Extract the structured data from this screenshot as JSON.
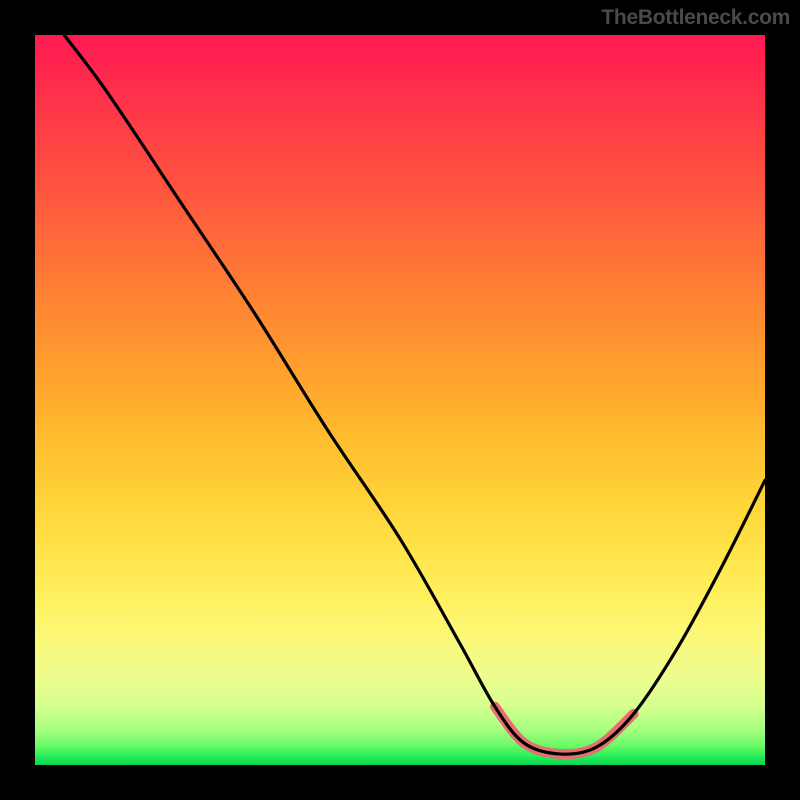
{
  "attribution": "TheBottleneck.com",
  "chart_data": {
    "type": "line",
    "title": "",
    "xlabel": "",
    "ylabel": "",
    "xlim": [
      0,
      100
    ],
    "ylim": [
      0,
      100
    ],
    "grid": false,
    "region_band": {
      "x_start": 62,
      "x_end": 82,
      "color": "#e76f6f"
    },
    "curve_points": [
      {
        "x": 4,
        "y": 100
      },
      {
        "x": 10,
        "y": 92
      },
      {
        "x": 20,
        "y": 77
      },
      {
        "x": 30,
        "y": 62
      },
      {
        "x": 40,
        "y": 46
      },
      {
        "x": 50,
        "y": 31
      },
      {
        "x": 58,
        "y": 17
      },
      {
        "x": 63,
        "y": 8
      },
      {
        "x": 67,
        "y": 3
      },
      {
        "x": 72,
        "y": 1.5
      },
      {
        "x": 77,
        "y": 2.5
      },
      {
        "x": 82,
        "y": 7
      },
      {
        "x": 88,
        "y": 16
      },
      {
        "x": 94,
        "y": 27
      },
      {
        "x": 100,
        "y": 39
      }
    ],
    "gradient_stops": [
      {
        "pos": 0,
        "color": "#ff1a52"
      },
      {
        "pos": 50,
        "color": "#ffa92e"
      },
      {
        "pos": 80,
        "color": "#fff05f"
      },
      {
        "pos": 100,
        "color": "#0ad656"
      }
    ]
  }
}
